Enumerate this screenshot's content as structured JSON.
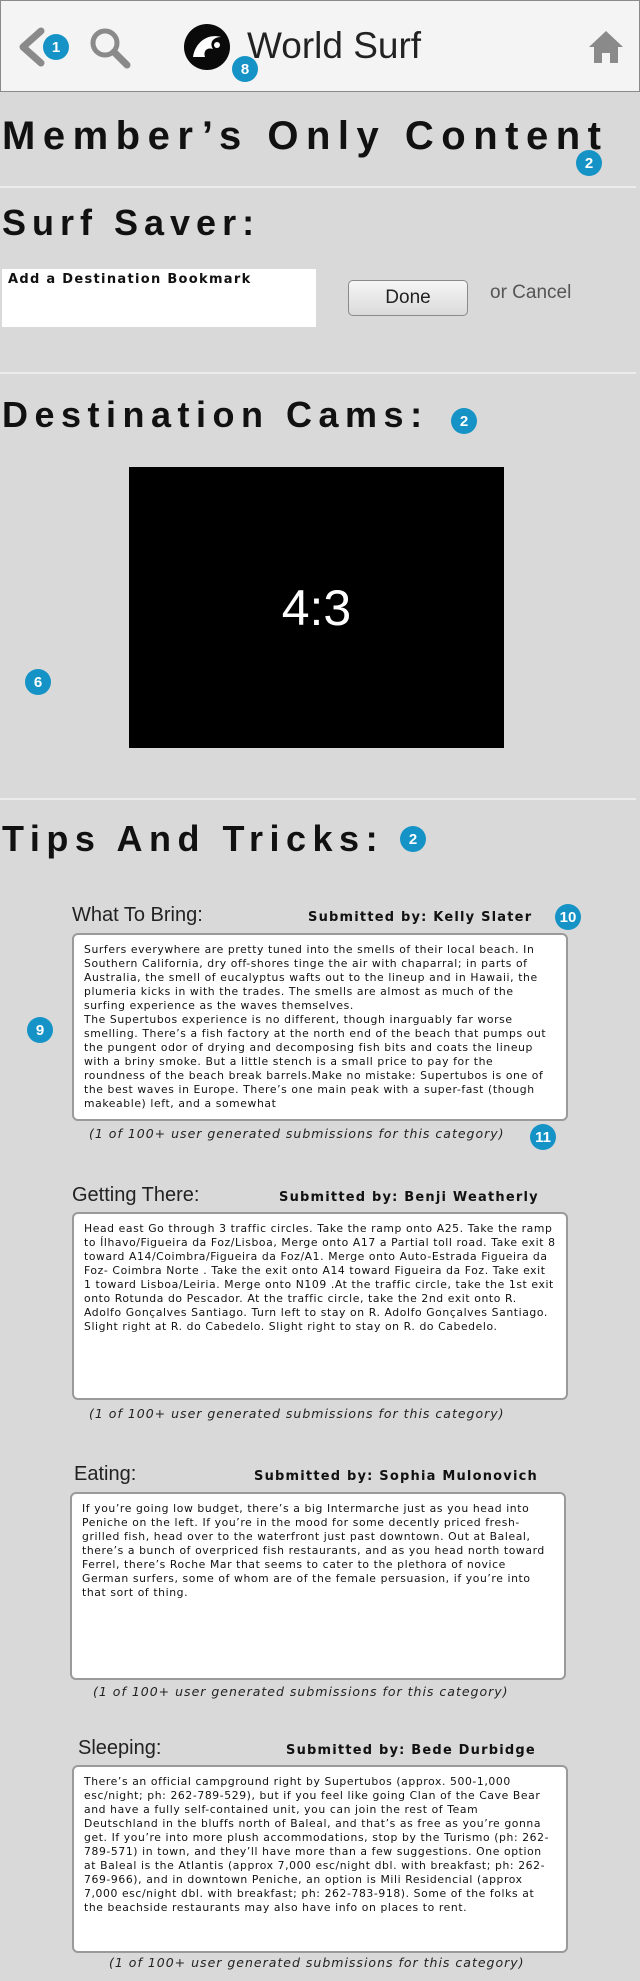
{
  "header": {
    "title": "World Surf",
    "back_badge": "1",
    "logo_badge": "8"
  },
  "members": {
    "title": "Member’s Only Content",
    "badge": "2"
  },
  "surf_saver": {
    "title": "Surf Saver:",
    "input_placeholder": "Add a Destination Bookmark",
    "done_label": "Done",
    "cancel_label": "or Cancel"
  },
  "cams": {
    "title": "Destination Cams:",
    "badge": "2",
    "video_label": "4:3",
    "side_badge": "6"
  },
  "tips": {
    "title": "Tips And Tricks:",
    "badge": "2",
    "side_badge": "9",
    "submitter_badge": "10",
    "count_badge": "11",
    "categories": [
      {
        "title": "What To Bring:",
        "submitter": "Submitted by: Kelly Slater",
        "body": "Surfers everywhere are pretty tuned into the smells of their local beach. In Southern California, dry off-shores tinge the air with chaparral; in parts of Australia, the smell of eucalyptus wafts out to the lineup and in Hawaii, the plumeria kicks in with the trades. The smells are almost as much of the surfing experience as the waves themselves.\nThe Supertubos experience is no different, though inarguably far worse smelling. There’s a fish factory at the north end of the beach that pumps out the pungent odor of drying and decomposing fish bits and coats the lineup with a briny smoke. But a little stench is a small price to pay for the roundness of the beach break barrels.Make no mistake: Supertubos is one of the best waves in Europe. There’s one main peak with a super-fast (though makeable) left, and a somewhat",
        "count": "(1 of 100+ user generated submissions for this category)"
      },
      {
        "title": "Getting There:",
        "submitter": "Submitted by: Benji Weatherly",
        "body": "Head east Go through 3 traffic circles. Take the ramp onto A25. Take the ramp to Ílhavo/Figueira da Foz/Lisboa, Merge onto A17 a Partial toll road. Take exit 8 toward A14/Coimbra/Figueira da Foz/A1. Merge onto Auto-Estrada Figueira da Foz- Coimbra Norte . Take the exit onto A14 toward Figueira da Foz. Take exit 1 toward Lisboa/Leiria. Merge onto N109 .At the traffic circle, take the 1st exit onto Rotunda do Pescador. At the traffic circle, take the 2nd exit onto R. Adolfo Gonçalves Santiago. Turn left to stay on R. Adolfo Gonçalves Santiago. Slight right at R. do Cabedelo. Slight right to stay on R. do Cabedelo.",
        "count": "(1 of 100+ user generated submissions for this category)"
      },
      {
        "title": "Eating:",
        "submitter": "Submitted by: Sophia Mulonovich",
        "body": "If you’re going low budget, there’s a big Intermarche just as you head into Peniche on the left. If you’re in the mood for some decently priced fresh-grilled fish, head over to the waterfront just past downtown. Out at Baleal, there’s a bunch of overpriced fish restaurants, and as you head north toward Ferrel, there’s Roche Mar that seems to cater to the plethora of novice German surfers, some of whom are of the female persuasion, if you’re into that sort of thing.",
        "count": "(1 of 100+ user generated submissions for this category)"
      },
      {
        "title": "Sleeping:",
        "submitter": "Submitted by: Bede Durbidge",
        "body": "There’s an official campground right by Supertubos (approx. 500-1,000 esc/night; ph: 262-789-529), but if you feel like going Clan of the Cave Bear and have a fully self-contained unit, you can join the rest of Team Deutschland in the bluffs north of Baleal, and that’s as free as you’re gonna get. If you’re into more plush accommodations, stop by the Turismo (ph: 262-789-571) in town, and they’ll have more than a few suggestions. One option at Baleal is the Atlantis (approx 7,000 esc/night dbl. with breakfast; ph: 262-769-966), and in downtown Peniche, an option is Mili Residencial (approx 7,000 esc/night dbl. with breakfast; ph: 262-783-918). Some of the folks at the beachside restaurants may also have info on places to rent.",
        "count": "(1 of 100+ user generated submissions for this category)"
      }
    ]
  },
  "colors": {
    "badge": "#1593c6",
    "background": "#d9d9d9",
    "video": "#000000"
  }
}
